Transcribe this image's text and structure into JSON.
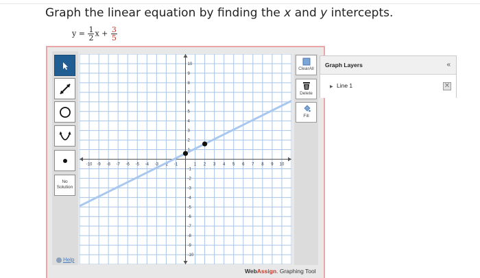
{
  "question": {
    "prefix": "Graph the linear equation by finding the ",
    "var_x": "x",
    "middle": " and ",
    "var_y": "y",
    "suffix": " intercepts."
  },
  "equation": {
    "lhs": "y =",
    "slope_num": "1",
    "slope_den": "2",
    "var": "x +",
    "intercept_num": "3",
    "intercept_den": "5"
  },
  "tools": [
    {
      "name": "pointer-tool",
      "icon": "pointer-icon"
    },
    {
      "name": "line-tool",
      "icon": "line-icon"
    },
    {
      "name": "circle-tool",
      "icon": "circle-icon"
    },
    {
      "name": "parabola-tool",
      "icon": "parabola-icon"
    },
    {
      "name": "point-tool",
      "icon": "point-icon"
    }
  ],
  "no_solution": {
    "line1": "No",
    "line2": "Solution"
  },
  "help_label": "Help",
  "right_buttons": {
    "clear_all": "ClearAll",
    "delete": "Delete",
    "fill": "Fill"
  },
  "graph": {
    "x_ticks": [
      "-10",
      "-9",
      "-8",
      "-7",
      "-6",
      "-5",
      "-4",
      "-3",
      "-2",
      "-1",
      "1",
      "2",
      "3",
      "4",
      "5",
      "6",
      "7",
      "8",
      "9",
      "10"
    ],
    "y_ticks": [
      "10",
      "9",
      "8",
      "7",
      "6",
      "5",
      "4",
      "3",
      "2",
      "1",
      "-1",
      "-2",
      "-3",
      "-4",
      "-5",
      "-6",
      "-7",
      "-8",
      "-9",
      "-10"
    ],
    "line": {
      "slope": 0.5,
      "intercept": 0.6,
      "color": "#a9c8ef"
    },
    "points": [
      {
        "x": 0,
        "y": 0.6
      },
      {
        "x": 2,
        "y": 1.6
      }
    ]
  },
  "brand": {
    "web": "Web",
    "assign": "Assign",
    "suffix": ". Graphing Tool"
  },
  "layers": {
    "title": "Graph Layers",
    "collapse": "«",
    "items": [
      {
        "label": "Line 1"
      }
    ]
  },
  "colors": {
    "frame_border": "#e9a7a7",
    "selected_tool": "#1f5d93",
    "accent_red": "#c0392b"
  }
}
